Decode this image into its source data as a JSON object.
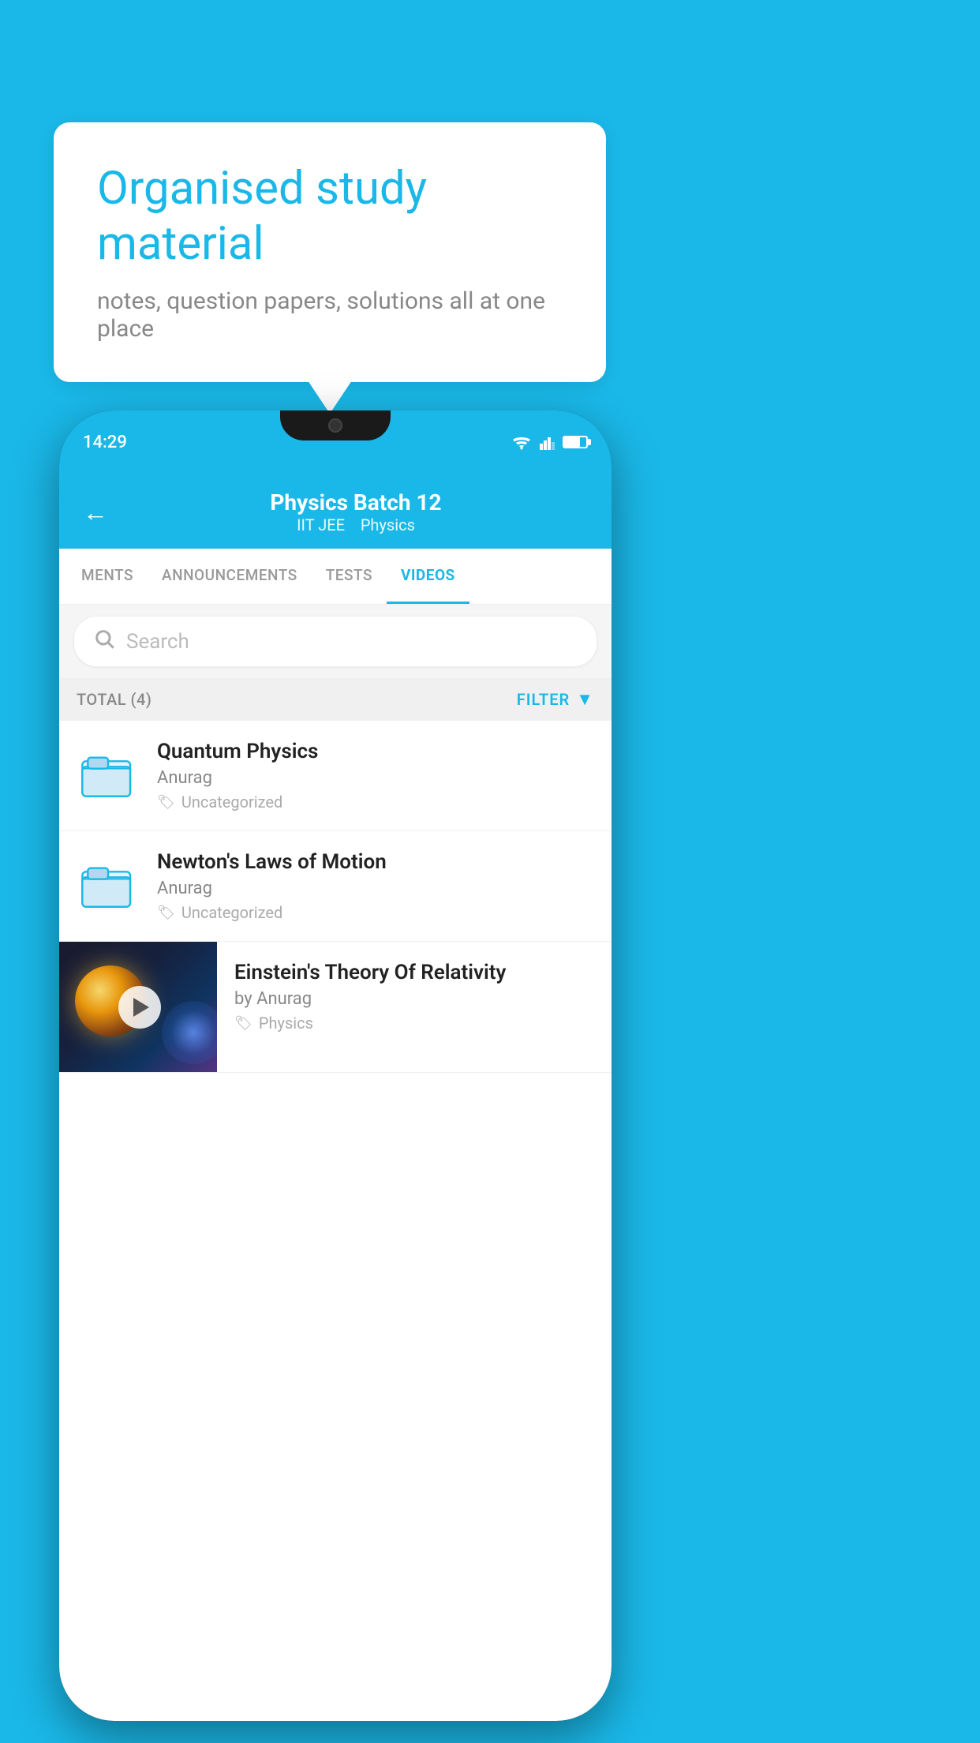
{
  "background_color": "#1ab8e8",
  "speech_bubble": {
    "title": "Organised study material",
    "subtitle": "notes, question papers, solutions all at one place"
  },
  "phone": {
    "status_bar": {
      "time": "14:29"
    },
    "app_header": {
      "title": "Physics Batch 12",
      "subtitle_part1": "IIT JEE",
      "subtitle_part2": "Physics",
      "back_label": "←"
    },
    "tabs": [
      {
        "label": "MENTS",
        "active": false
      },
      {
        "label": "ANNOUNCEMENTS",
        "active": false
      },
      {
        "label": "TESTS",
        "active": false
      },
      {
        "label": "VIDEOS",
        "active": true
      }
    ],
    "search": {
      "placeholder": "Search"
    },
    "filter_bar": {
      "total_label": "TOTAL (4)",
      "filter_label": "FILTER"
    },
    "videos": [
      {
        "title": "Quantum Physics",
        "author": "Anurag",
        "tag": "Uncategorized",
        "has_thumb": false
      },
      {
        "title": "Newton's Laws of Motion",
        "author": "Anurag",
        "tag": "Uncategorized",
        "has_thumb": false
      },
      {
        "title": "Einstein's Theory Of Relativity",
        "author": "by Anurag",
        "tag": "Physics",
        "has_thumb": true
      }
    ]
  }
}
